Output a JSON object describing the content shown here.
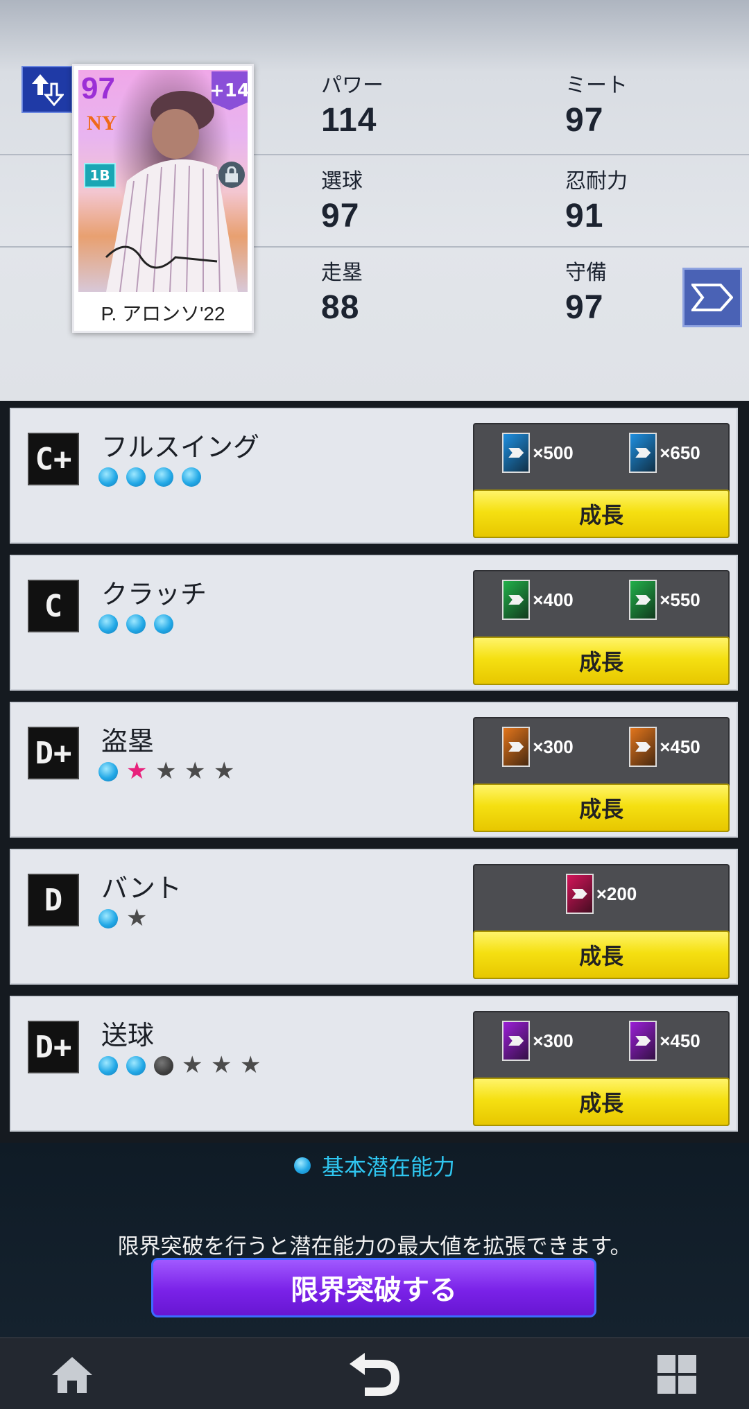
{
  "card": {
    "overall": "97",
    "boost": "+14",
    "team_logo": "NY",
    "position": "1B",
    "name": "P. アロンソ'22"
  },
  "stats": [
    {
      "label": "パワー",
      "value": "114"
    },
    {
      "label": "ミート",
      "value": "97"
    },
    {
      "label": "選球",
      "value": "97"
    },
    {
      "label": "忍耐力",
      "value": "91"
    },
    {
      "label": "走塁",
      "value": "88"
    },
    {
      "label": "守備",
      "value": "97"
    }
  ],
  "skills": [
    {
      "grade": "C+",
      "name": "フルスイング",
      "dots": 4,
      "pink_stars": 0,
      "dark_dots": 0,
      "stars": 0,
      "costs": [
        {
          "qty": "×500",
          "color": "#1e8fe0"
        },
        {
          "qty": "×650",
          "color": "#1e8fe0"
        }
      ],
      "button": "成長"
    },
    {
      "grade": "C",
      "name": "クラッチ",
      "dots": 3,
      "pink_stars": 0,
      "dark_dots": 0,
      "stars": 0,
      "costs": [
        {
          "qty": "×400",
          "color": "#22b04a"
        },
        {
          "qty": "×550",
          "color": "#22b04a"
        }
      ],
      "button": "成長"
    },
    {
      "grade": "D+",
      "name": "盗塁",
      "dots": 1,
      "pink_stars": 1,
      "dark_dots": 0,
      "stars": 3,
      "costs": [
        {
          "qty": "×300",
          "color": "#e2751c"
        },
        {
          "qty": "×450",
          "color": "#e2751c"
        }
      ],
      "button": "成長"
    },
    {
      "grade": "D",
      "name": "バント",
      "dots": 1,
      "pink_stars": 0,
      "dark_dots": 0,
      "stars": 1,
      "costs": [
        {
          "qty": "×200",
          "color": "#d4145a"
        }
      ],
      "button": "成長"
    },
    {
      "grade": "D+",
      "name": "送球",
      "dots": 2,
      "pink_stars": 0,
      "dark_dots": 1,
      "stars": 3,
      "costs": [
        {
          "qty": "×300",
          "color": "#9a1fd6"
        },
        {
          "qty": "×450",
          "color": "#9a1fd6"
        }
      ],
      "button": "成長"
    }
  ],
  "legend": "基本潜在能力",
  "info": "限界突破を行うと潜在能力の最大値を拡張できます。",
  "limit_break_button": "限界突破する",
  "nav": {
    "home": "home-icon",
    "back": "back-icon",
    "menu": "grid-icon"
  }
}
